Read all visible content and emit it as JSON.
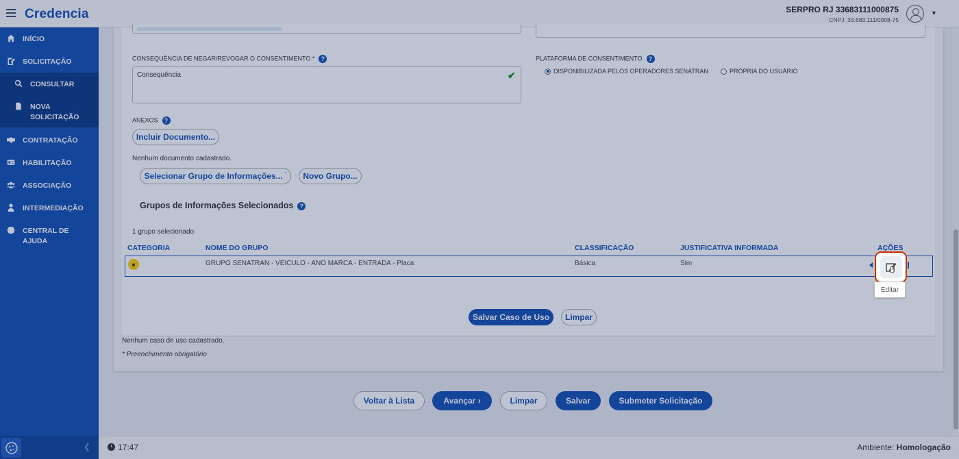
{
  "header": {
    "logo": "Credencia",
    "user_name": "SERPRO RJ 33683111000875",
    "user_cnpj": "CNPJ: 33.683.111/0008-75"
  },
  "sidebar": {
    "items": [
      {
        "label": "INÍCIO",
        "icon": "home-icon"
      },
      {
        "label": "SOLICITAÇÃO",
        "icon": "edit-doc-icon"
      },
      {
        "label": "CONSULTAR",
        "icon": "search-icon"
      },
      {
        "label": "NOVA SOLICITAÇÃO",
        "icon": "file-icon"
      },
      {
        "label": "CONTRATAÇÃO",
        "icon": "handshake-icon"
      },
      {
        "label": "HABILITAÇÃO",
        "icon": "id-card-icon"
      },
      {
        "label": "ASSOCIAÇÃO",
        "icon": "users-icon"
      },
      {
        "label": "INTERMEDIAÇÃO",
        "icon": "user-tie-icon"
      },
      {
        "label": "CENTRAL DE AJUDA",
        "icon": "question-circle-icon"
      }
    ]
  },
  "form": {
    "consequencia_label": "CONSEQUÊNCIA DE NEGAR/REVOGAR O CONSENTIMENTO *",
    "consequencia_value": "Consequência",
    "plataforma_label": "PLATAFORMA DE CONSENTIMENTO",
    "plataforma_options": [
      "DISPONIBILIZADA PELOS OPERADORES SENATRAN",
      "PRÓPRIA DO USUÁRIO"
    ],
    "plataforma_selected": 0,
    "anexos_label": "ANEXOS",
    "incluir_documento": "Incluir Documento...",
    "nenhum_documento": "Nenhum documento cadastrado.",
    "selecionar_grupo": "Selecionar Grupo de Informações...",
    "novo_grupo": "Novo Grupo...",
    "grupos_title": "Grupos de Informações Selecionados",
    "grupos_count": "1 grupo selecionado"
  },
  "table": {
    "headers": [
      "CATEGORIA",
      "NOME DO GRUPO",
      "CLASSIFICAÇÃO",
      "JUSTIFICATIVA INFORMADA",
      "AÇÕES"
    ],
    "rows": [
      {
        "nome": "GRUPO SENATRAN - VEICULO - ANO MARCA - ENTRADA - Placa",
        "classificacao": "Básica",
        "justificativa": "Sim"
      }
    ],
    "tooltip": "Editar"
  },
  "case_actions": {
    "salvar_caso": "Salvar Caso de Uso",
    "limpar": "Limpar"
  },
  "nenhum_caso": "Nenhum caso de uso cadastrado.",
  "obrigatorio": "* Preenchimento obrigatório",
  "bottom_actions": {
    "voltar": "Voltar à Lista",
    "avancar": "Avançar ›",
    "limpar": "Limpar",
    "salvar": "Salvar",
    "submeter": "Submeter Solicitação"
  },
  "footer": {
    "time": "17:47",
    "env_label": "Ambiente:",
    "env_value": "Homologação"
  },
  "colors": {
    "primary": "#1351b4",
    "success": "#168821",
    "highlight": "#cc3300"
  }
}
